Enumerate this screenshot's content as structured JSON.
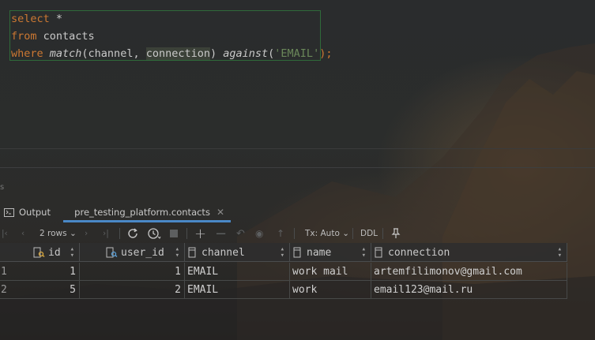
{
  "editor": {
    "lines": [
      {
        "kw": "select",
        "rest": " *"
      },
      {
        "kw": "from",
        "rest": " contacts"
      },
      {
        "kw": "where",
        "fn": "match",
        "args_open": "(channel, ",
        "arg_hl": "connection",
        "args_close": ") ",
        "fn2": "against",
        "str": "'EMAIL'",
        "end": ");"
      }
    ]
  },
  "tabs": [
    {
      "label": "Output",
      "icon": "console-icon"
    },
    {
      "label": "pre_testing_platform.contacts",
      "icon": "table-icon",
      "active": true
    }
  ],
  "toolbar": {
    "rows_label": "2 rows",
    "tx_label": "Tx: Auto",
    "ddl_label": "DDL"
  },
  "grid": {
    "columns": [
      {
        "name": "id",
        "icon": "key-column-icon"
      },
      {
        "name": "user_id",
        "icon": "foreign-key-column-icon"
      },
      {
        "name": "channel",
        "icon": "column-icon"
      },
      {
        "name": "name",
        "icon": "column-icon"
      },
      {
        "name": "connection",
        "icon": "column-icon"
      }
    ],
    "rows": [
      {
        "rownum": "1",
        "id": "1",
        "user_id": "1",
        "channel": "EMAIL",
        "name": "work mail",
        "connection": "artemfilimonov@gmail.com"
      },
      {
        "rownum": "2",
        "id": "5",
        "user_id": "2",
        "channel": "EMAIL",
        "name": "work",
        "connection": "email123@mail.ru"
      }
    ]
  },
  "colors": {
    "keyword": "#cc7832",
    "string": "#6a8759",
    "accent": "#4a88c7",
    "frame": "#2f6b3a"
  }
}
